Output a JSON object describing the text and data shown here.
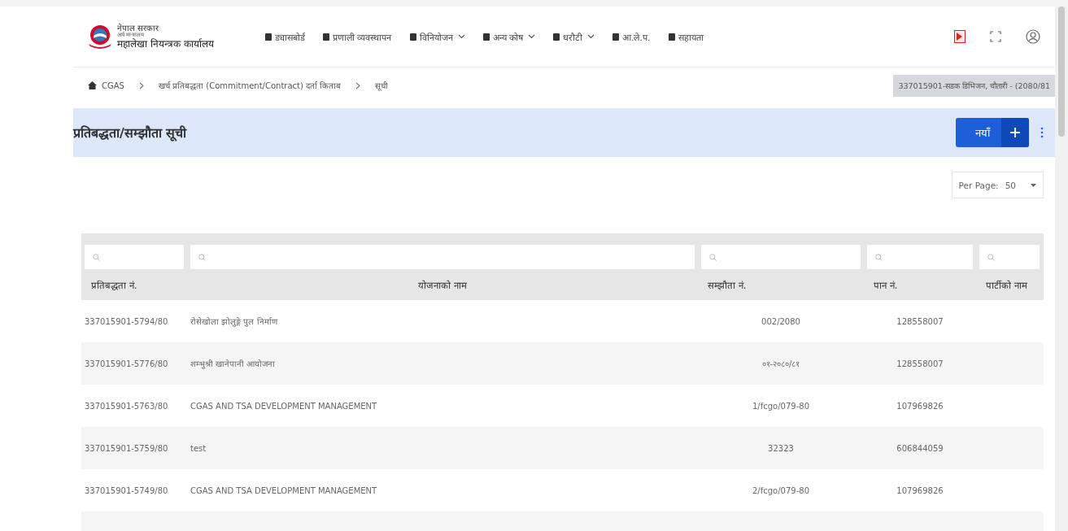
{
  "header": {
    "logo_lines": [
      "नेपाल सरकार",
      "अर्थ मन्त्रालय",
      "महालेखा नियन्त्रक कार्यालय"
    ],
    "nav": [
      {
        "label": "ड्यासबोर्ड",
        "dropdown": false
      },
      {
        "label": "प्रणाली व्यवस्थापन",
        "dropdown": false
      },
      {
        "label": "विनियोजन",
        "dropdown": true
      },
      {
        "label": "अन्य कोष",
        "dropdown": true
      },
      {
        "label": "धरौटी",
        "dropdown": true
      },
      {
        "label": "आ.ले.प.",
        "dropdown": false
      },
      {
        "label": "सहायता",
        "dropdown": false
      }
    ]
  },
  "breadcrumb": [
    {
      "label": "CGAS",
      "kind": "home"
    },
    {
      "label": "खर्च प्रतिबद्धता (Commitment/Contract) दर्ता किताब",
      "kind": "link"
    },
    {
      "label": "सूची",
      "kind": "current"
    }
  ],
  "office": "337015901-सडक डिभिजन, चौतारी - (2080/81",
  "page": {
    "title": "प्रतिबद्धता/सम्झौता सूची",
    "new_button": "नयाँ"
  },
  "per_page": {
    "label": "Per Page:",
    "value": "50"
  },
  "table": {
    "columns": [
      "प्रतिबद्धता नं.",
      "योजनाको नाम",
      "सम्झौता नं.",
      "पान नं.",
      "पार्टीको नाम"
    ],
    "rows": [
      [
        "337015901-5794/80",
        "रोसेखोला झोलुङ्गे पुल निर्माण",
        "002/2080",
        "128558007"
      ],
      [
        "337015901-5776/80",
        "शम्भुश्री खानेपानी आयोजना",
        "०१-२०८०/८१",
        "128558007"
      ],
      [
        "337015901-5763/80",
        "CGAS AND TSA DEVELOPMENT MANAGEMENT",
        "1/fcgo/079-80",
        "107969826"
      ],
      [
        "337015901-5759/80",
        "test",
        "32323",
        "606844059"
      ],
      [
        "337015901-5749/80",
        "CGAS AND TSA DEVELOPMENT MANAGEMENT",
        "2/fcgo/079-80",
        "107969826"
      ]
    ]
  }
}
